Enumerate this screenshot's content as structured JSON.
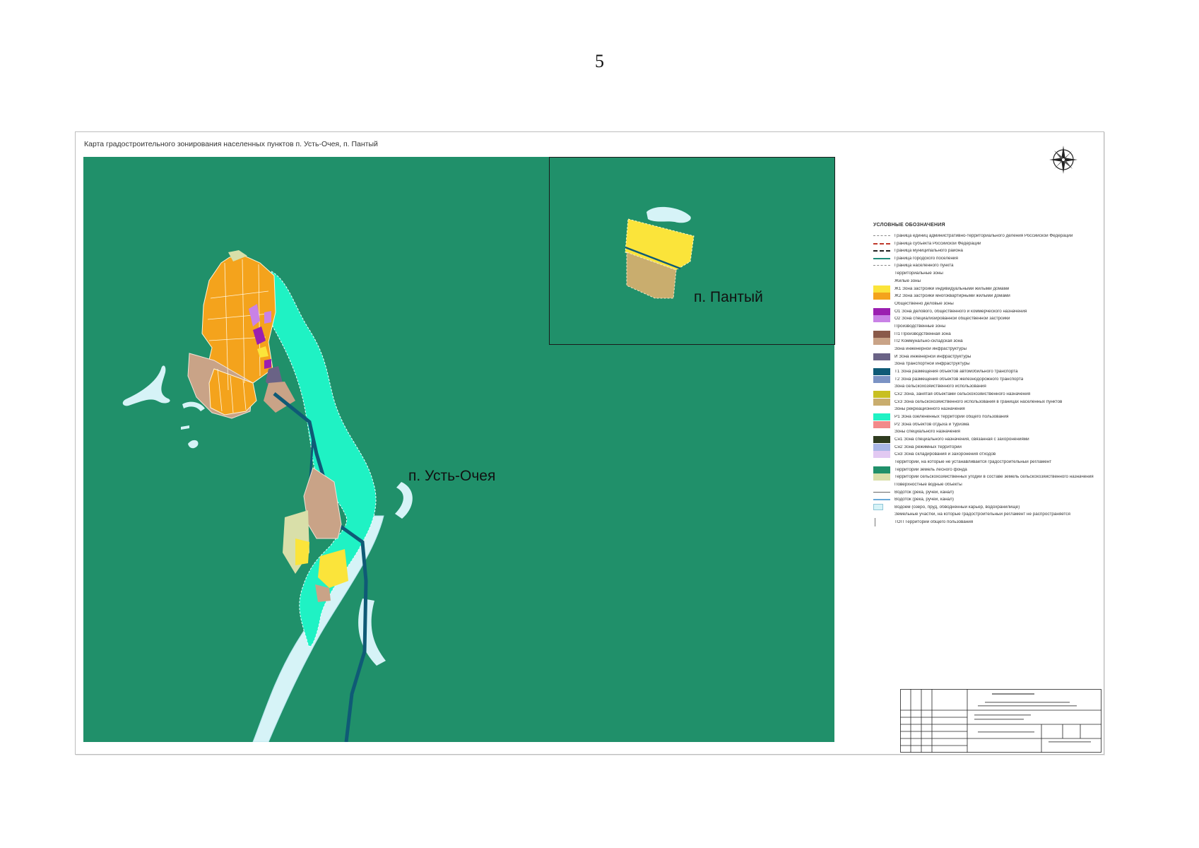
{
  "page": {
    "number": "5"
  },
  "map": {
    "title": "Карта градостроительного зонирования населенных пунктов п. Усть-Очея, п. Пантый",
    "label_main": "п. Усть-Очея",
    "label_inset": "п. Пантый",
    "colors": {
      "forest": "#20906a",
      "water": "#d6f3f7",
      "recreation": "#1ff2c4",
      "residential_individual": "#fbe43a",
      "residential_multi": "#f4a31c",
      "industrial": "#c9a387",
      "communal": "#bca08a",
      "agricultural": "#d9dfa9",
      "transport": "#0f5a76",
      "public": "#b36be0",
      "engineering": "#6a6386"
    }
  },
  "legend": {
    "title": "УСЛОВНЫЕ ОБОЗНАЧЕНИЯ",
    "rows": [
      {
        "kind": "line",
        "style": "l5",
        "text": "Граница единиц административно-территориального деления Российской Федерации"
      },
      {
        "kind": "line",
        "style": "l2",
        "text": "Граница субъекта Российской Федерации"
      },
      {
        "kind": "line",
        "style": "l3",
        "text": "Граница муниципального района"
      },
      {
        "kind": "line",
        "style": "l4",
        "text": "Граница городского поселения"
      },
      {
        "kind": "line",
        "style": "l5",
        "text": "Граница населенного пункта"
      },
      {
        "kind": "head",
        "text": "Территориальные зоны"
      },
      {
        "kind": "head",
        "text": "Жилые зоны"
      },
      {
        "kind": "fill",
        "color": "#fbe43a",
        "text": "Ж1 Зона застройки индивидуальными жилыми домами"
      },
      {
        "kind": "fill",
        "color": "#f4a31c",
        "text": "Ж2 Зона застройки многоквартирными жилыми домами"
      },
      {
        "kind": "head",
        "text": "Общественно деловые зоны"
      },
      {
        "kind": "fill",
        "color": "#9b1fb0",
        "text": "О1 Зона делового, общественного и коммерческого назначения"
      },
      {
        "kind": "fill",
        "color": "#c982e6",
        "text": "О2 Зона специализированной общественной застройки"
      },
      {
        "kind": "head",
        "text": "Производственные зоны"
      },
      {
        "kind": "fill",
        "color": "#8a5a4a",
        "text": "П1 Производственная зона"
      },
      {
        "kind": "fill",
        "color": "#c9a387",
        "text": "П2 Коммунально-складская зона"
      },
      {
        "kind": "head",
        "text": "Зона инженерной инфраструктуры"
      },
      {
        "kind": "fill",
        "color": "#6a6386",
        "text": "И Зона инженерной инфраструктуры"
      },
      {
        "kind": "head",
        "text": "Зона транспортной инфраструктуры"
      },
      {
        "kind": "fill",
        "color": "#0f5a76",
        "text": "Т1 Зона размещения объектов автомобильного транспорта"
      },
      {
        "kind": "fill",
        "color": "#7b93c4",
        "text": "Т2 Зона размещения объектов железнодорожного транспорта"
      },
      {
        "kind": "head",
        "text": "Зона сельскохозяйственного использования"
      },
      {
        "kind": "fill",
        "color": "#c8bf22",
        "text": "Сх2 Зона, занятая объектами сельскохозяйственного назначения"
      },
      {
        "kind": "fill",
        "color": "#c9ad6e",
        "text": "Сх3 Зона сельскохозяйственного использования в границах населенных пунктов"
      },
      {
        "kind": "head",
        "text": "Зоны рекреационного назначения"
      },
      {
        "kind": "fill",
        "color": "#1ff2c4",
        "text": "Р1 Зона озелененных территорий общего пользования"
      },
      {
        "kind": "fill",
        "color": "#f28a8a",
        "text": "Р2 Зона объектов отдыха и туризма"
      },
      {
        "kind": "head",
        "text": "Зоны специального назначения"
      },
      {
        "kind": "fill",
        "color": "#2f3b1f",
        "text": "Сн1 Зона специального назначения, связанная с захоронениями"
      },
      {
        "kind": "fill",
        "color": "#a9b6e6",
        "text": "Сн2 Зона режимных территорий"
      },
      {
        "kind": "fill",
        "color": "#e2c9f2",
        "text": "Сн3 Зона складирования и захоронения отходов"
      },
      {
        "kind": "head",
        "text": "Территории, на которые не устанавливается градостроительный регламент"
      },
      {
        "kind": "fill",
        "color": "#20906a",
        "text": "Территории земель лесного фонда"
      },
      {
        "kind": "fill",
        "color": "#d9dfa9",
        "text": "Территории сельскохозяйственных угодий в составе земель сельскохозяйственного назначения"
      },
      {
        "kind": "head",
        "text": "Поверхностные водные объекты"
      },
      {
        "kind": "line",
        "style": "water",
        "text": "Водоток (река, ручей, канал)"
      },
      {
        "kind": "line",
        "style": "water2",
        "text": "Водоток (река, ручей, канал)"
      },
      {
        "kind": "lake",
        "text": "Водоем (озеро, пруд, обводненный карьер, водохранилище)"
      },
      {
        "kind": "head",
        "text": "Земельные участки, на которые градостроительный регламент не распространяется"
      },
      {
        "kind": "vline",
        "text": "ТОП Территории общего пользования"
      }
    ]
  }
}
